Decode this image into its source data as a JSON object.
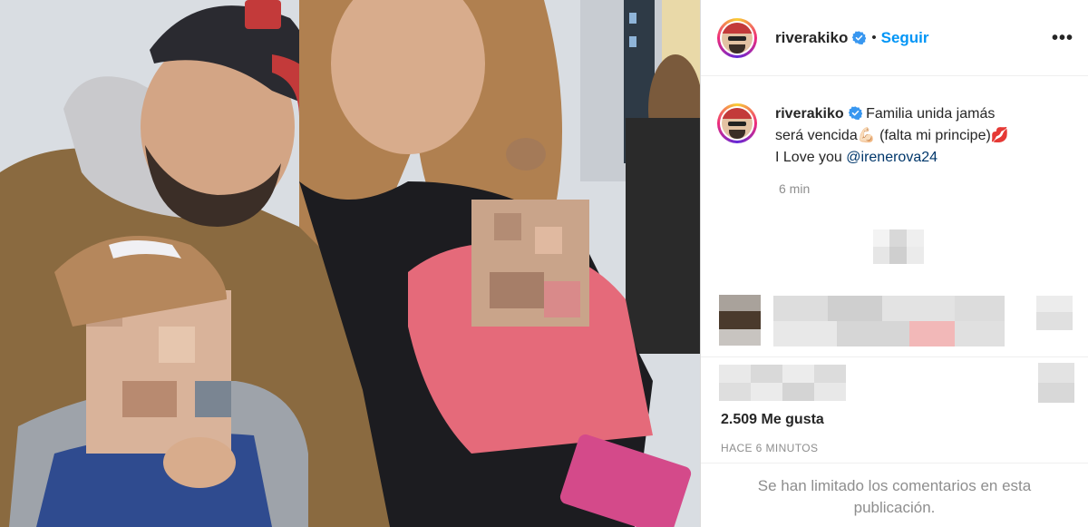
{
  "post": {
    "username": "riverakiko",
    "separator": "•",
    "follow_label": "Seguir",
    "more_label": "•••",
    "caption": {
      "line1": "Familia unida jamás",
      "line2": "será vencida",
      "line2_emoji": "💪🏻",
      "line2_rest": " (falta mi principe)",
      "line2_emoji2": "💋",
      "line3": "I Love you ",
      "mention": "@irenerova24"
    },
    "time_ago": "6 min",
    "likes": "2.509 Me gusta",
    "timestamp": "HACE 6 MINUTOS",
    "comments_limited": "Se han limitado los comentarios en esta publicación."
  },
  "icons": {
    "verified": "verified-badge-icon",
    "more": "more-options-icon"
  },
  "colors": {
    "link": "#0095f6",
    "mention": "#00376b",
    "verified": "#3897f0",
    "muted": "#8e8e8e"
  }
}
